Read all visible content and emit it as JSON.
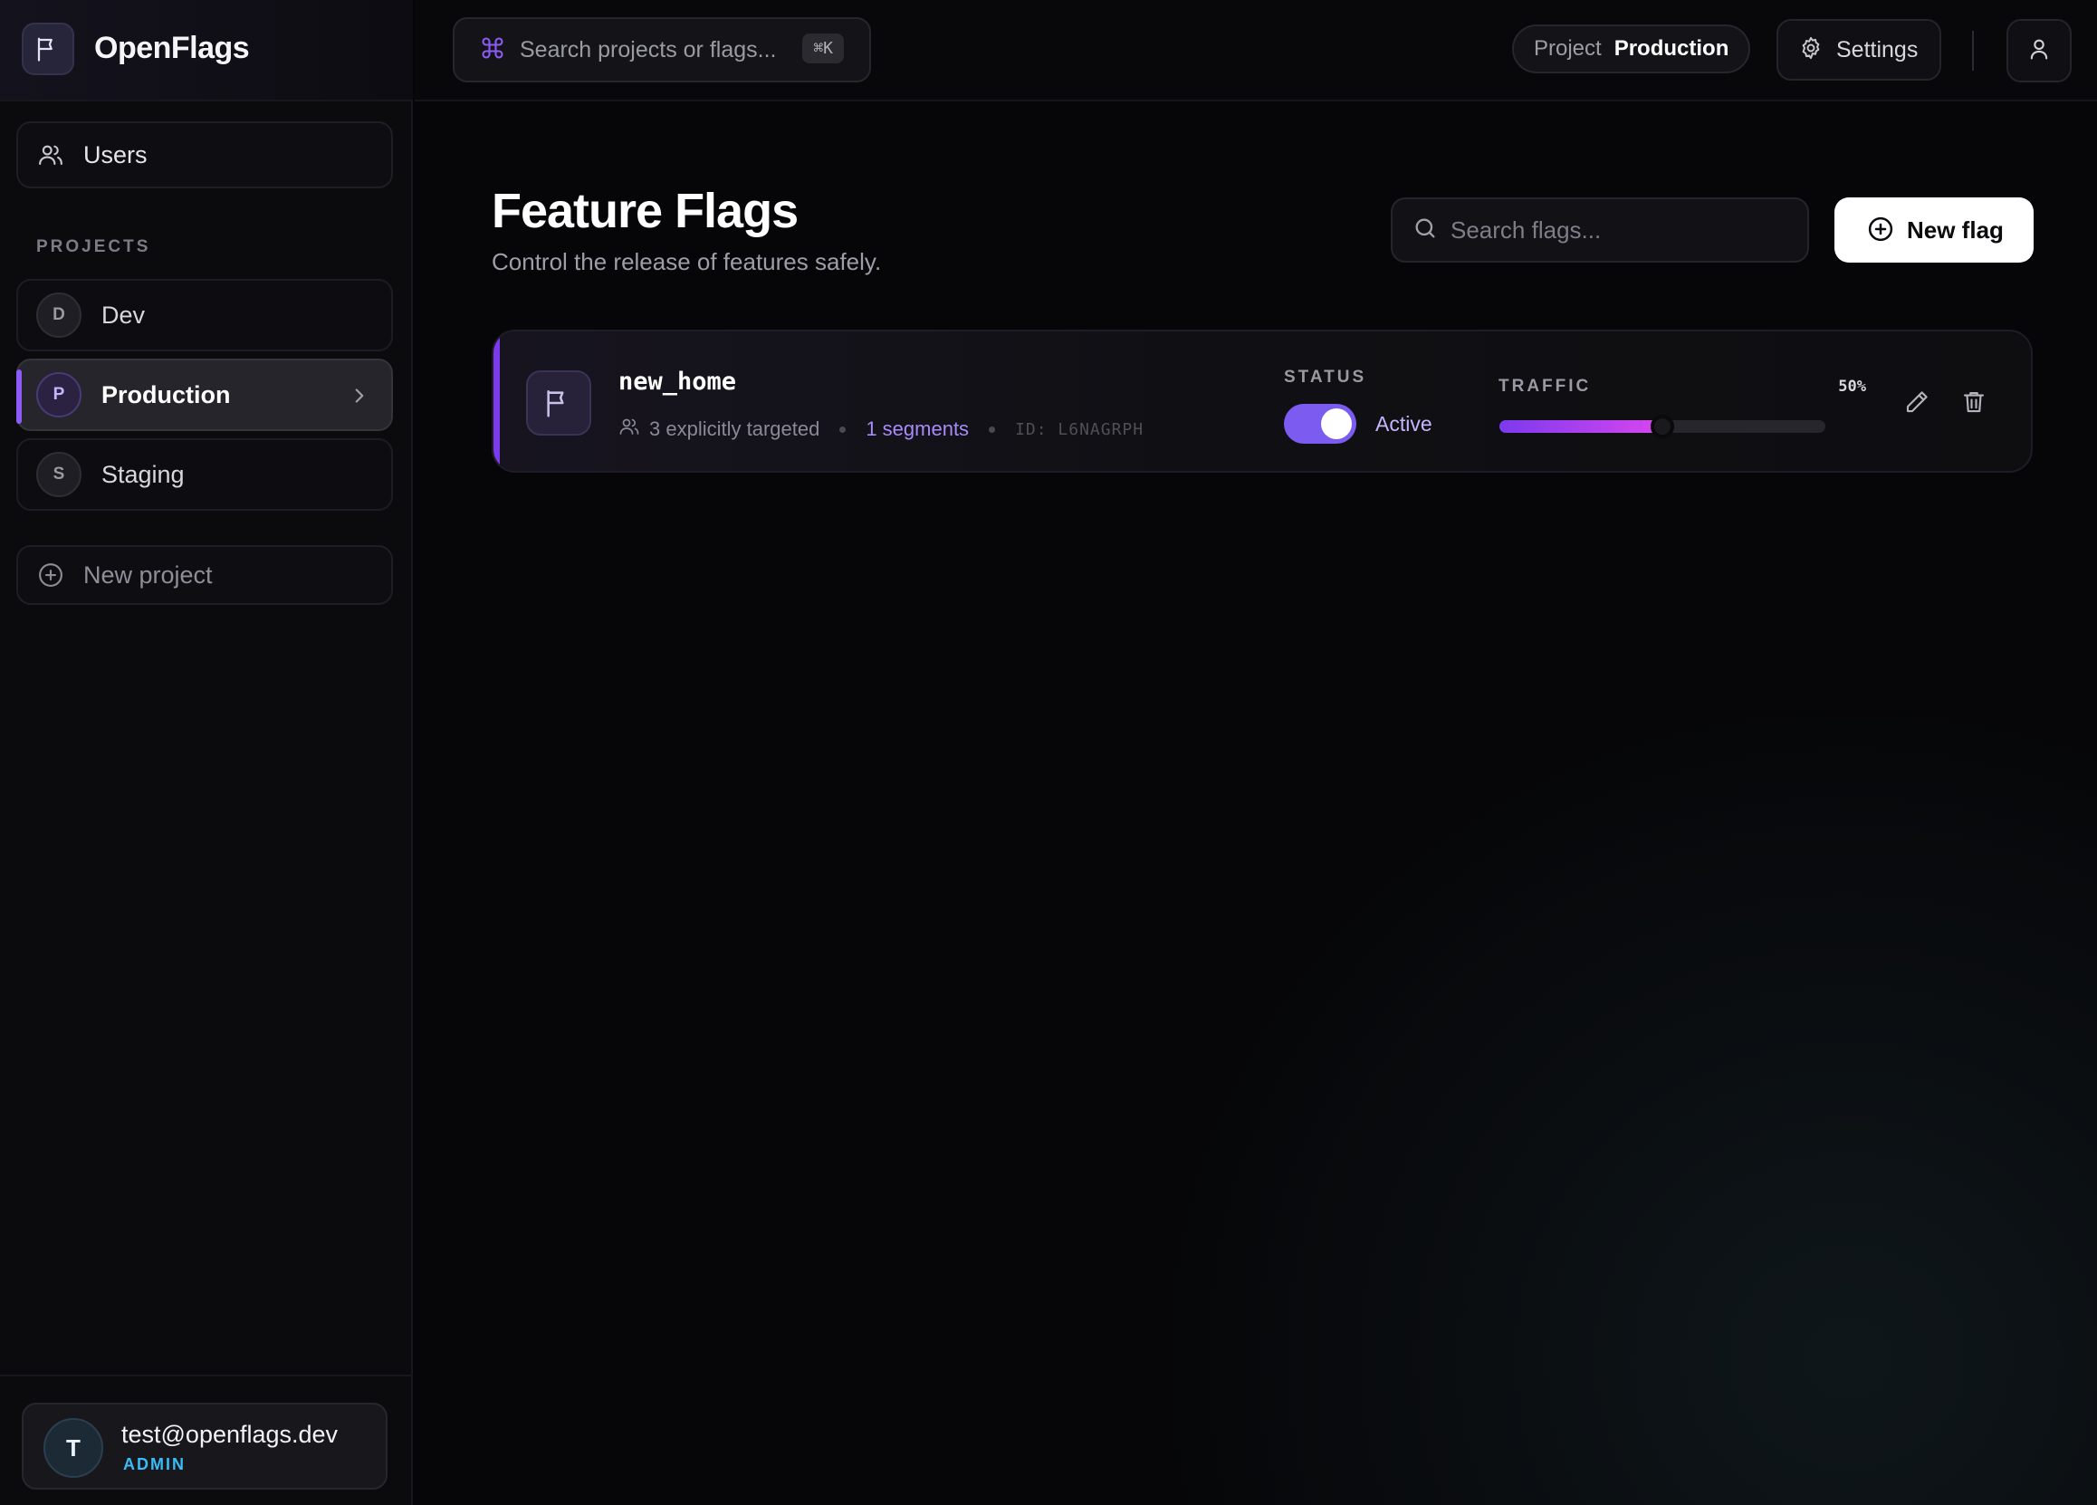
{
  "app": {
    "name": "OpenFlags",
    "logo_icon": "flag-icon"
  },
  "sidebar": {
    "users_label": "Users",
    "projects_heading": "PROJECTS",
    "projects": [
      {
        "initial": "D",
        "name": "Dev",
        "active": false
      },
      {
        "initial": "P",
        "name": "Production",
        "active": true
      },
      {
        "initial": "S",
        "name": "Staging",
        "active": false
      }
    ],
    "new_project_label": "New project",
    "user": {
      "initial": "T",
      "email": "test@openflags.dev",
      "role": "ADMIN"
    }
  },
  "topbar": {
    "search_placeholder": "Search projects or flags...",
    "search_shortcut": "⌘K",
    "project_key": "Project",
    "project_value": "Production",
    "settings_label": "Settings"
  },
  "main": {
    "title": "Feature Flags",
    "subtitle": "Control the release of features safely.",
    "search_placeholder": "Search flags...",
    "new_flag_label": "New flag",
    "flags": [
      {
        "key": "new_home",
        "targeted": "3 explicitly targeted",
        "segments": "1 segments",
        "id": "ID: L6NAGRPH",
        "status_heading": "STATUS",
        "status": "Active",
        "enabled": true,
        "traffic_heading": "TRAFFIC",
        "traffic_label": "50%",
        "traffic": 0.5
      }
    ]
  },
  "colors": {
    "accent": "#7c3aed",
    "accent_light": "#a78bfa",
    "role": "#38bdf8",
    "background": "#060608"
  }
}
